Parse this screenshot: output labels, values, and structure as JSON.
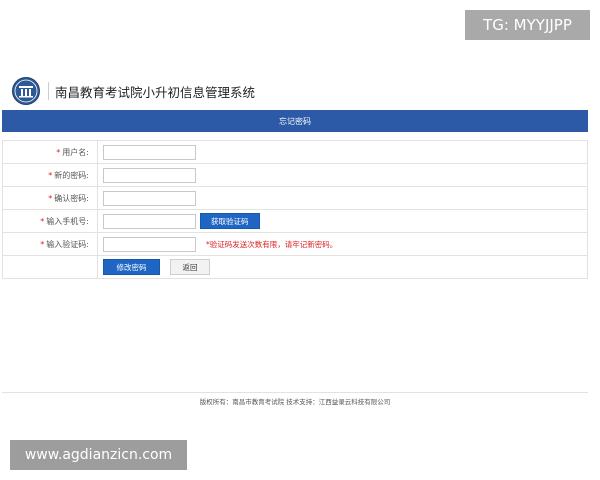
{
  "badge_top": "TG: MYYJJPP",
  "header": {
    "logo_icon": "education-exam-emblem-icon",
    "title": "南昌教育考试院小升初信息管理系统"
  },
  "bar": {
    "title": "忘记密码"
  },
  "form": {
    "required_mark": "*",
    "rows": [
      {
        "label": "用户名:",
        "value": ""
      },
      {
        "label": "新的密码:",
        "value": ""
      },
      {
        "label": "确认密码:",
        "value": ""
      },
      {
        "label": "输入手机号:",
        "value": ""
      },
      {
        "label": "输入验证码:",
        "value": ""
      }
    ],
    "get_code_label": "获取验证码",
    "warning": "*验证码发送次数有限，请牢记新密码。",
    "submit_label": "修改密码",
    "back_label": "返回"
  },
  "footer": {
    "text": "版权所有：南昌市教育考试院  技术支持：江西益录云科技有限公司"
  },
  "watermark": "www.agdianzicn.com",
  "colors": {
    "primary": "#2c5aa6",
    "button": "#1f66c4",
    "required": "#dd2222"
  }
}
